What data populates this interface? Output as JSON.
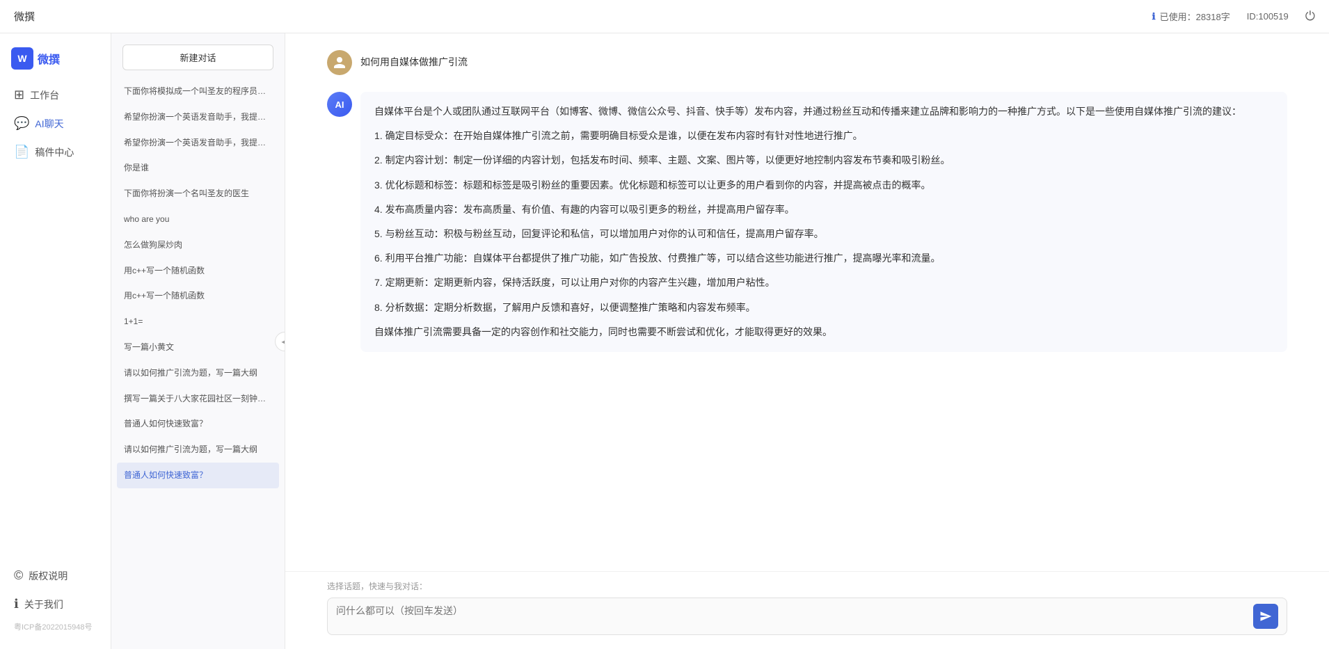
{
  "topbar": {
    "title": "微撰",
    "usage_label": "已使用：28318字",
    "id_label": "ID:100519",
    "usage_icon": "ℹ"
  },
  "sidebar": {
    "items": [
      {
        "id": "workspace",
        "label": "工作台",
        "icon": "⊞"
      },
      {
        "id": "aichat",
        "label": "AI聊天",
        "icon": "💬",
        "active": true
      },
      {
        "id": "drafts",
        "label": "稿件中心",
        "icon": "📄"
      }
    ],
    "bottom_items": [
      {
        "id": "copyright",
        "label": "版权说明",
        "icon": "©"
      },
      {
        "id": "about",
        "label": "关于我们",
        "icon": "ℹ"
      }
    ],
    "copyright_text": "粤ICP备2022015948号"
  },
  "history": {
    "new_chat_label": "新建对话",
    "items": [
      {
        "id": "h1",
        "text": "下面你将模拟成一个叫圣友的程序员，我说...",
        "selected": false
      },
      {
        "id": "h2",
        "text": "希望你扮演一个英语发音助手，我提供给你...",
        "selected": false
      },
      {
        "id": "h3",
        "text": "希望你扮演一个英语发音助手，我提供给你...",
        "selected": false
      },
      {
        "id": "h4",
        "text": "你是谁",
        "selected": false
      },
      {
        "id": "h5",
        "text": "下面你将扮演一个名叫圣友的医生",
        "selected": false
      },
      {
        "id": "h6",
        "text": "who are you",
        "selected": false
      },
      {
        "id": "h7",
        "text": "怎么做狗屎炒肉",
        "selected": false
      },
      {
        "id": "h8",
        "text": "用c++写一个随机函数",
        "selected": false
      },
      {
        "id": "h9",
        "text": "用c++写一个随机函数",
        "selected": false
      },
      {
        "id": "h10",
        "text": "1+1=",
        "selected": false
      },
      {
        "id": "h11",
        "text": "写一篇小黄文",
        "selected": false
      },
      {
        "id": "h12",
        "text": "请以如何推广引流为题，写一篇大纲",
        "selected": false
      },
      {
        "id": "h13",
        "text": "撰写一篇关于八大家花园社区一刻钟便民生...",
        "selected": false
      },
      {
        "id": "h14",
        "text": "普通人如何快速致富？",
        "selected": false
      },
      {
        "id": "h15",
        "text": "请以如何推广引流为题，写一篇大纲",
        "selected": false
      },
      {
        "id": "h16",
        "text": "普通人如何快速致富？",
        "selected": true
      }
    ]
  },
  "chat": {
    "messages": [
      {
        "id": "m1",
        "role": "user",
        "avatar_text": "👤",
        "content": "如何用自媒体做推广引流"
      },
      {
        "id": "m2",
        "role": "ai",
        "avatar_text": "AI",
        "content": "自媒体平台是个人或团队通过互联网平台（如博客、微博、微信公众号、抖音、快手等）发布内容，并通过粉丝互动和传播来建立品牌和影响力的一种推广方式。以下是一些使用自媒体推广引流的建议：",
        "items": [
          "1. 确定目标受众：在开始自媒体推广引流之前，需要明确目标受众是谁，以便在发布内容时有针对性地进行推广。",
          "2. 制定内容计划：制定一份详细的内容计划，包括发布时间、频率、主题、文案、图片等，以便更好地控制内容发布节奏和吸引粉丝。",
          "3. 优化标题和标签：标题和标签是吸引粉丝的重要因素。优化标题和标签可以让更多的用户看到你的内容，并提高被点击的概率。",
          "4. 发布高质量内容：发布高质量、有价值、有趣的内容可以吸引更多的粉丝，并提高用户留存率。",
          "5. 与粉丝互动：积极与粉丝互动，回复评论和私信，可以增加用户对你的认可和信任，提高用户留存率。",
          "6. 利用平台推广功能：自媒体平台都提供了推广功能，如广告投放、付费推广等，可以结合这些功能进行推广，提高曝光率和流量。",
          "7. 定期更新：定期更新内容，保持活跃度，可以让用户对你的内容产生兴趣，增加用户粘性。",
          "8. 分析数据：定期分析数据，了解用户反馈和喜好，以便调整推广策略和内容发布频率。"
        ],
        "footer": "自媒体推广引流需要具备一定的内容创作和社交能力，同时也需要不断尝试和优化，才能取得更好的效果。"
      }
    ],
    "input_placeholder": "问什么都可以（按回车发送）",
    "quick_topics_label": "选择话题，快速与我对话："
  },
  "logo": {
    "text": "微撰",
    "brand_color": "#3a5af0"
  }
}
